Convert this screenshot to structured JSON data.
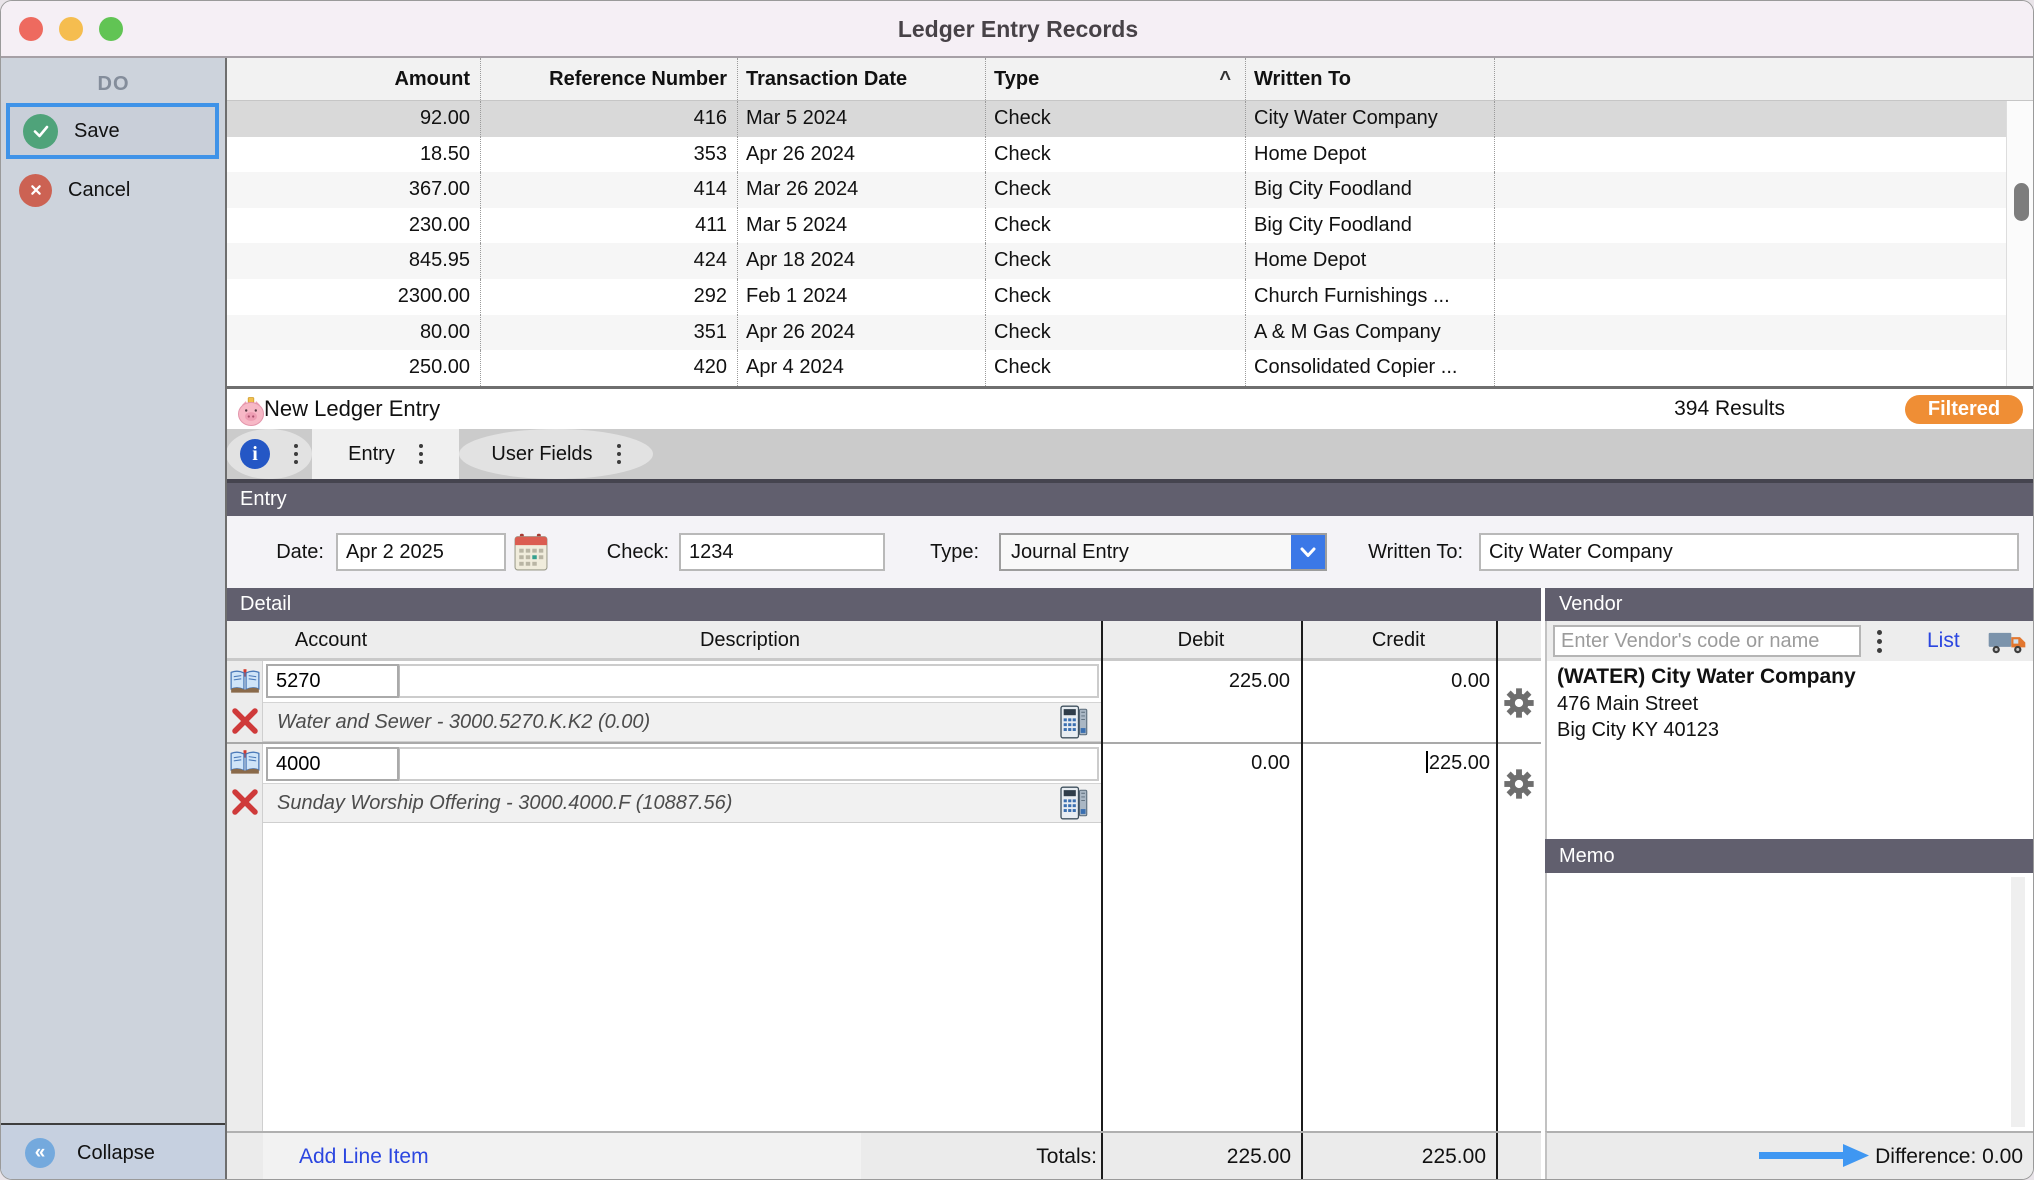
{
  "window": {
    "title": "Ledger Entry Records"
  },
  "sidebar": {
    "header": "DO",
    "save_label": "Save",
    "cancel_label": "Cancel",
    "collapse_label": "Collapse"
  },
  "records": {
    "columns": {
      "amount": "Amount",
      "reference": "Reference Number",
      "date": "Transaction Date",
      "type": "Type",
      "written_to": "Written To"
    },
    "sort_indicator": "^",
    "rows": [
      {
        "amount": "92.00",
        "reference": "416",
        "date": "Mar 5 2024",
        "type": "Check",
        "written_to": "City Water Company"
      },
      {
        "amount": "18.50",
        "reference": "353",
        "date": "Apr 26 2024",
        "type": "Check",
        "written_to": "Home Depot"
      },
      {
        "amount": "367.00",
        "reference": "414",
        "date": "Mar 26 2024",
        "type": "Check",
        "written_to": "Big City Foodland"
      },
      {
        "amount": "230.00",
        "reference": "411",
        "date": "Mar 5 2024",
        "type": "Check",
        "written_to": "Big City Foodland"
      },
      {
        "amount": "845.95",
        "reference": "424",
        "date": "Apr 18 2024",
        "type": "Check",
        "written_to": "Home Depot"
      },
      {
        "amount": "2300.00",
        "reference": "292",
        "date": "Feb 1 2024",
        "type": "Check",
        "written_to": "Church Furnishings ..."
      },
      {
        "amount": "80.00",
        "reference": "351",
        "date": "Apr 26 2024",
        "type": "Check",
        "written_to": "A & M Gas Company"
      },
      {
        "amount": "250.00",
        "reference": "420",
        "date": "Apr 4 2024",
        "type": "Check",
        "written_to": "Consolidated Copier ..."
      }
    ]
  },
  "results_bar": {
    "title": "New Ledger Entry",
    "results": "394 Results",
    "filter_badge": "Filtered"
  },
  "tabs": {
    "entry": "Entry",
    "user_fields": "User Fields"
  },
  "entry": {
    "section_header": "Entry",
    "date_label": "Date:",
    "date_value": "Apr 2 2025",
    "check_label": "Check:",
    "check_value": "1234",
    "type_label": "Type:",
    "type_value": "Journal Entry",
    "written_to_label": "Written To:",
    "written_to_value": "City Water Company"
  },
  "detail": {
    "section_header": "Detail",
    "columns": {
      "account": "Account",
      "description": "Description",
      "debit": "Debit",
      "credit": "Credit"
    },
    "rows": [
      {
        "account": "5270",
        "description": "",
        "debit": "225.00",
        "credit": "0.00",
        "account_info": "Water and Sewer - 3000.5270.K.K2 (0.00)"
      },
      {
        "account": "4000",
        "description": "",
        "debit": "0.00",
        "credit": "225.00",
        "account_info": "Sunday Worship Offering - 3000.4000.F (10887.56)"
      }
    ],
    "add_line_item": "Add Line Item",
    "totals_label": "Totals:",
    "total_debit": "225.00",
    "total_credit": "225.00"
  },
  "vendor": {
    "section_header": "Vendor",
    "search_placeholder": "Enter Vendor's code or name",
    "list_link": "List",
    "name": "(WATER) City Water Company",
    "address_line1": "476 Main Street",
    "address_line2": "Big City KY 40123"
  },
  "memo": {
    "section_header": "Memo"
  },
  "totals_bar": {
    "difference": "Difference: 0.00"
  },
  "colors": {
    "header_bar": "#615f6e",
    "filtered_badge": "#ef8e35",
    "accent_blue": "#3b78e7",
    "link_blue": "#2b46e0",
    "save_green": "#4fa37a",
    "cancel_red": "#cc6253",
    "difference_arrow": "#3f97f2"
  }
}
